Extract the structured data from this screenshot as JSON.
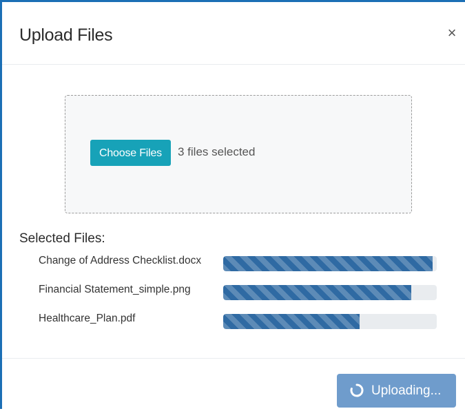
{
  "dialog": {
    "title": "Upload Files",
    "close_glyph": "×"
  },
  "dropzone": {
    "choose_button_label": "Choose Files",
    "selection_status": "3 files selected"
  },
  "selected_files": {
    "heading": "Selected Files:",
    "items": [
      {
        "name": "Change of Address Checklist.docx",
        "progress": 0.98
      },
      {
        "name": "Financial Statement_simple.png",
        "progress": 0.88
      },
      {
        "name": "Healthcare_Plan.pdf",
        "progress": 0.64
      }
    ]
  },
  "footer": {
    "upload_button_label": "Uploading...",
    "upload_button_icon": "spinner-icon"
  },
  "colors": {
    "accent_border": "#1c6fb5",
    "choose_button": "#17a2b8",
    "progress_fill": "#2f6aa3",
    "progress_track": "#e9ecef",
    "upload_button_disabled": "#6f9ccc"
  }
}
